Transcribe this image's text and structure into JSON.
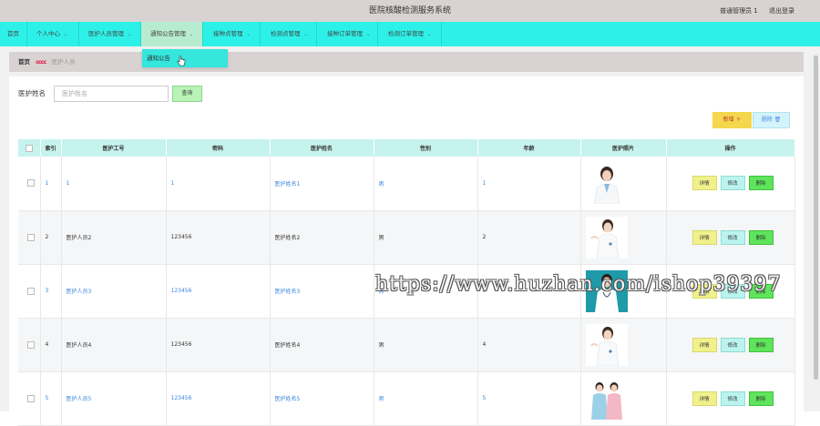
{
  "header": {
    "title": "医院核酸检测服务系统",
    "user_label": "普通管理员 1",
    "logout_label": "退出登录"
  },
  "nav": {
    "items": [
      {
        "label": "首页",
        "chevron": false
      },
      {
        "label": "个人中心",
        "chevron": true
      },
      {
        "label": "医护人员管理",
        "chevron": true
      },
      {
        "label": "通知公告管理",
        "chevron": true,
        "active": true
      },
      {
        "label": "接种点管理",
        "chevron": true
      },
      {
        "label": "检测点管理",
        "chevron": true
      },
      {
        "label": "接种订单管理",
        "chevron": true
      },
      {
        "label": "检测订单管理",
        "chevron": true
      }
    ],
    "dropdown_item": "通知公告"
  },
  "breadcrumb": {
    "home": "首页",
    "separator": "cccc",
    "current": "医护人员"
  },
  "search": {
    "label": "医护姓名",
    "placeholder": "医护姓名",
    "button": "查询"
  },
  "actions": {
    "add": "新增 ＋",
    "delete": "删除 🗑"
  },
  "table": {
    "columns": [
      "索引",
      "医护工号",
      "密码",
      "医护姓名",
      "性别",
      "年龄",
      "医护照片",
      "操作"
    ],
    "rows": [
      {
        "index": "1",
        "work_no": "1",
        "password": "1",
        "name": "医护姓名1",
        "gender": "男",
        "age": "1",
        "blue": true
      },
      {
        "index": "2",
        "work_no": "医护人员2",
        "password": "123456",
        "name": "医护姓名2",
        "gender": "男",
        "age": "2",
        "blue": false
      },
      {
        "index": "3",
        "work_no": "医护人员3",
        "password": "123456",
        "name": "医护姓名3",
        "gender": "男",
        "age": "3",
        "blue": true
      },
      {
        "index": "4",
        "work_no": "医护人员4",
        "password": "123456",
        "name": "医护姓名4",
        "gender": "男",
        "age": "4",
        "blue": false
      },
      {
        "index": "5",
        "work_no": "医护人员5",
        "password": "123456",
        "name": "医护姓名5",
        "gender": "男",
        "age": "5",
        "blue": true
      }
    ],
    "op_detail": "详情",
    "op_edit": "修改",
    "op_delete": "删除"
  },
  "watermark": "https://www.huzhan.com/ishop39397"
}
